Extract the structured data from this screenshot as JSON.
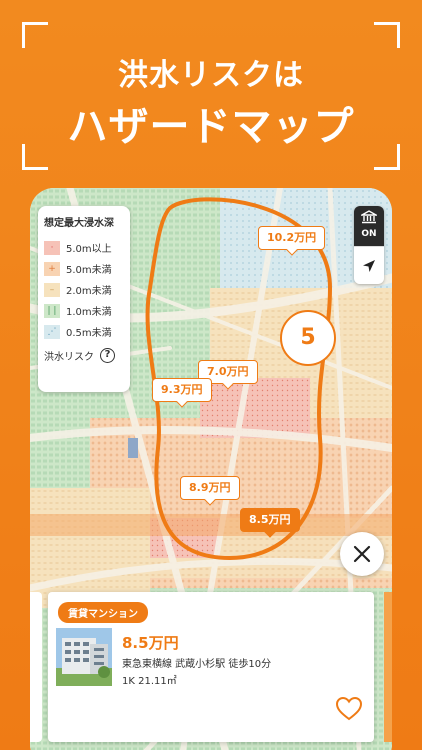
{
  "header": {
    "line1": "洪水リスクは",
    "line2": "ハザードマップ"
  },
  "legend": {
    "title": "想定最大浸水深",
    "items": [
      {
        "label": "5.0m以上",
        "color": "#f2a3b0",
        "mark": "·"
      },
      {
        "label": "5.0m未満",
        "color": "#f7c9a8",
        "mark": "+"
      },
      {
        "label": "2.0m未満",
        "color": "#f8e0b8",
        "mark": "–"
      },
      {
        "label": "1.0m未満",
        "color": "#bfe3c6",
        "mark": "| |"
      },
      {
        "label": "0.5m未満",
        "color": "#cfe6f2",
        "mark": "⋰"
      }
    ],
    "footer_label": "洪水リスク",
    "help": "?"
  },
  "controls": {
    "hazard_icon": "building-icon",
    "hazard_state": "ON",
    "locate_icon": "location-arrow-icon"
  },
  "map": {
    "cluster_count": "5",
    "price_tags": [
      {
        "label": "10.2万円"
      },
      {
        "label": "7.0万円"
      },
      {
        "label": "9.3万円"
      },
      {
        "label": "8.9万円"
      },
      {
        "label": "8.5万円",
        "selected": true
      }
    ]
  },
  "listing": {
    "badge": "賃貸マンション",
    "price": "8.5万円",
    "access": "東急東横線  武蔵小杉駅  徒歩10分",
    "spec": "1K  21.11㎡"
  },
  "colors": {
    "accent": "#ef7b15",
    "hazard_button": "#2b2b2b"
  }
}
